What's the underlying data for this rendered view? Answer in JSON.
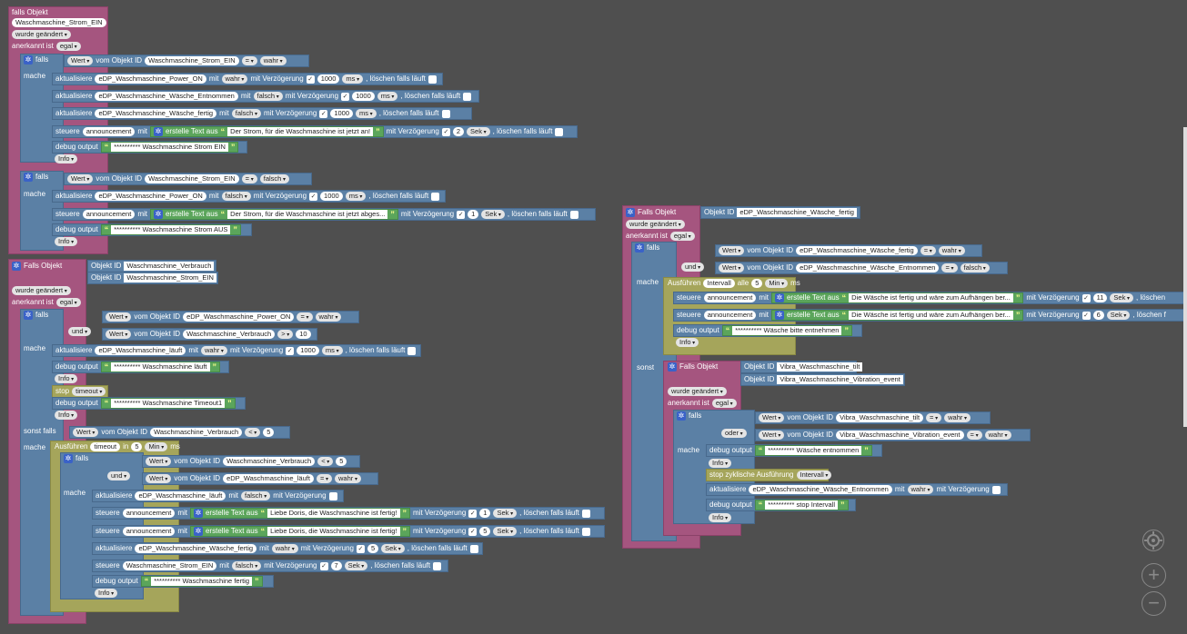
{
  "b1": {
    "falls_objekt": "falls Objekt",
    "obj": "Waschmaschine_Strom_EIN",
    "changed": "wurde geändert",
    "ack": "anerkannt ist",
    "ack_val": "egal",
    "falls": "falls",
    "mache": "mache",
    "cond1": {
      "wert": "Wert",
      "vom": "vom Objekt ID",
      "id": "Waschmaschine_Strom_EIN",
      "op": "=",
      "val": "wahr"
    },
    "r1": {
      "akt": "aktualisiere",
      "id": "eDP_Waschmaschine_Power_ON",
      "mit": "mit",
      "val": "wahr",
      "verz": "mit Verzögerung",
      "ms": "1000",
      "unit": "ms",
      "tail": ", löschen falls läuft"
    },
    "r2": {
      "akt": "aktualisiere",
      "id": "eDP_Waschmaschine_Wäsche_Entnommen",
      "mit": "mit",
      "val": "falsch",
      "verz": "mit Verzögerung",
      "ms": "1000",
      "unit": "ms",
      "tail": ", löschen falls läuft"
    },
    "r3": {
      "akt": "aktualisiere",
      "id": "eDP_Waschmaschine_Wäsche_fertig",
      "mit": "mit",
      "val": "falsch",
      "verz": "mit Verzögerung",
      "ms": "1000",
      "unit": "ms",
      "tail": ", löschen falls läuft"
    },
    "r4": {
      "st": "steuere",
      "id": "announcement",
      "mit": "mit",
      "erst": "erstelle Text aus",
      "text": "Der Strom, für die Waschmaschine ist jetzt an!",
      "verz": "mit Verzögerung",
      "n": "2",
      "unit": "Sek",
      "tail": ", löschen falls läuft"
    },
    "r5": {
      "debug": "debug output",
      "text": "********** Waschmaschine Strom EIN"
    },
    "info": "Info",
    "cond2": {
      "wert": "Wert",
      "vom": "vom Objekt ID",
      "id": "Waschmaschine_Strom_EIN",
      "op": "=",
      "val": "falsch"
    },
    "r6": {
      "akt": "aktualisiere",
      "id": "eDP_Waschmaschine_Power_ON",
      "mit": "mit",
      "val": "falsch",
      "verz": "mit Verzögerung",
      "ms": "1000",
      "unit": "ms",
      "tail": ", löschen falls läuft"
    },
    "r7": {
      "st": "steuere",
      "id": "announcement",
      "mit": "mit",
      "erst": "erstelle Text aus",
      "text": "Der Strom, für die Waschmaschine ist jetzt abges...",
      "verz": "mit Verzögerung",
      "n": "1",
      "unit": "Sek",
      "tail": ", löschen falls läuft"
    },
    "r8": {
      "debug": "debug output",
      "text": "********** Waschmaschine Strom AUS"
    }
  },
  "b2": {
    "falls_objekt": "Falls Objekt",
    "oid": "Objekt ID",
    "obj1": "Waschmaschine_Verbrauch",
    "obj2": "Waschmaschine_Strom_EIN",
    "changed": "wurde geändert",
    "ack": "anerkannt ist",
    "ack_val": "egal",
    "falls": "falls",
    "und": "und",
    "mache": "mache",
    "c1": {
      "wert": "Wert",
      "vom": "vom Objekt ID",
      "id": "eDP_Waschmaschine_Power_ON",
      "op": "=",
      "val": "wahr"
    },
    "c2": {
      "wert": "Wert",
      "vom": "vom Objekt ID",
      "id": "Waschmaschine_Verbrauch",
      "op": ">",
      "val": "10"
    },
    "r1": {
      "akt": "aktualisiere",
      "id": "eDP_Waschmaschine_läuft",
      "mit": "mit",
      "val": "wahr",
      "verz": "mit Verzögerung",
      "ms": "1000",
      "unit": "ms",
      "tail": ", löschen falls läuft"
    },
    "r2": {
      "debug": "debug output",
      "text": "********** Waschmaschine läuft"
    },
    "info": "Info",
    "stop": "stop",
    "timeout": "timeout",
    "r3": {
      "debug": "debug output",
      "text": "********** Waschmaschine Timeout1"
    },
    "sonst_falls": "sonst falls",
    "c3": {
      "wert": "Wert",
      "vom": "vom Objekt ID",
      "id": "Waschmaschine_Verbrauch",
      "op": "<",
      "val": "5"
    },
    "ausf": {
      "lbl": "Ausführen",
      "name": "timeout",
      "in": "in",
      "n": "5",
      "unit": "Min",
      "ms": "ms"
    },
    "c4": {
      "wert": "Wert",
      "vom": "vom Objekt ID",
      "id": "Waschmaschine_Verbrauch",
      "op": "<",
      "val": "5"
    },
    "c5": {
      "wert": "Wert",
      "vom": "vom Objekt ID",
      "id": "eDP_Waschmaschine_läuft",
      "op": "=",
      "val": "wahr"
    },
    "r4": {
      "akt": "aktualisiere",
      "id": "eDP_Waschmaschine_läuft",
      "mit": "mit",
      "val": "falsch",
      "verz": "mit Verzögerung"
    },
    "r5": {
      "st": "steuere",
      "id": "announcement",
      "mit": "mit",
      "erst": "erstelle Text aus",
      "text": "Liebe Doris, die Waschmaschine ist fertig!",
      "verz": "mit Verzögerung",
      "n": "1",
      "unit": "Sek",
      "tail": ", löschen falls läuft"
    },
    "r6": {
      "st": "steuere",
      "id": "announcement",
      "mit": "mit",
      "erst": "erstelle Text aus",
      "text": "Liebe Doris, die Waschmaschine ist fertig!",
      "verz": "mit Verzögerung",
      "n": "5",
      "unit": "Sek",
      "tail": ", löschen falls läuft"
    },
    "r7": {
      "akt": "aktualisiere",
      "id": "eDP_Waschmaschine_Wäsche_fertig",
      "mit": "mit",
      "val": "wahr",
      "verz": "mit Verzögerung",
      "n": "5",
      "unit": "Sek",
      "tail": ", löschen falls läuft"
    },
    "r8": {
      "st": "steuere",
      "id": "Waschmaschine_Strom_EIN",
      "mit": "mit",
      "val": "falsch",
      "verz": "mit Verzögerung",
      "n": "7",
      "unit": "Sek",
      "tail": ", löschen falls läuft"
    },
    "r9": {
      "debug": "debug output",
      "text": "********** Waschmaschine fertig"
    }
  },
  "b3": {
    "falls_objekt": "Falls Objekt",
    "oid": "Objekt ID",
    "obj": "eDP_Waschmaschine_Wäsche_fertig",
    "changed": "wurde geändert",
    "ack": "anerkannt ist",
    "ack_val": "egal",
    "falls": "falls",
    "und": "und",
    "mache": "mache",
    "c1": {
      "wert": "Wert",
      "vom": "vom Objekt ID",
      "id": "eDP_Waschmaschine_Wäsche_fertig",
      "op": "=",
      "val": "wahr"
    },
    "c2": {
      "wert": "Wert",
      "vom": "vom Objekt ID",
      "id": "eDP_Waschmaschine_Wäsche_Entnommen",
      "op": "=",
      "val": "falsch"
    },
    "ausf": {
      "lbl": "Ausführen",
      "name": "Intervall",
      "alle": "alle",
      "n": "5",
      "unit": "Min",
      "ms": "ms"
    },
    "r1": {
      "st": "steuere",
      "id": "announcement",
      "mit": "mit",
      "erst": "erstelle Text aus",
      "text": "Die Wäsche ist fertig und wäre zum Aufhängen ber...",
      "verz": "mit Verzögerung",
      "n": "11",
      "unit": "Sek",
      "tail": ", löschen"
    },
    "r2": {
      "st": "steuere",
      "id": "announcement",
      "mit": "mit",
      "erst": "erstelle Text aus",
      "text": "Die Wäsche ist fertig und wäre zum Aufhängen ber...",
      "verz": "mit Verzögerung",
      "n": "6",
      "unit": "Sek",
      "tail": ", löschen f"
    },
    "r3": {
      "debug": "debug output",
      "text": "********** Wäsche bitte entnehmen"
    },
    "info": "Info",
    "sonst": "sonst",
    "inner": {
      "falls_objekt": "Falls Objekt",
      "oid": "Objekt ID",
      "obj1": "Vibra_Waschmaschine_tilt",
      "obj2": "Vibra_Waschmaschine_Vibration_event",
      "changed": "wurde geändert",
      "ack": "anerkannt ist",
      "ack_val": "egal",
      "falls": "falls",
      "oder": "oder",
      "mache": "mache",
      "c1": {
        "wert": "Wert",
        "vom": "vom Objekt ID",
        "id": "Vibra_Waschmaschine_tilt",
        "op": "=",
        "val": "wahr"
      },
      "c2": {
        "wert": "Wert",
        "vom": "vom Objekt ID",
        "id": "Vibra_Waschmaschine_Vibration_event",
        "op": "=",
        "val": "wahr"
      },
      "r1": {
        "debug": "debug output",
        "text": "********** Wäsche entnommen"
      },
      "stop": {
        "lbl": "stop zyklische Ausführung",
        "name": "Intervall"
      },
      "r2": {
        "akt": "aktualisiere",
        "id": "eDP_Waschmaschine_Wäsche_Entnommen",
        "mit": "mit",
        "val": "wahr",
        "verz": "mit Verzögerung"
      },
      "r3": {
        "debug": "debug output",
        "text": "********** stop Intervall"
      }
    }
  },
  "controls": {
    "target": "target-icon",
    "zoom_in": "+",
    "zoom_out": "−"
  }
}
